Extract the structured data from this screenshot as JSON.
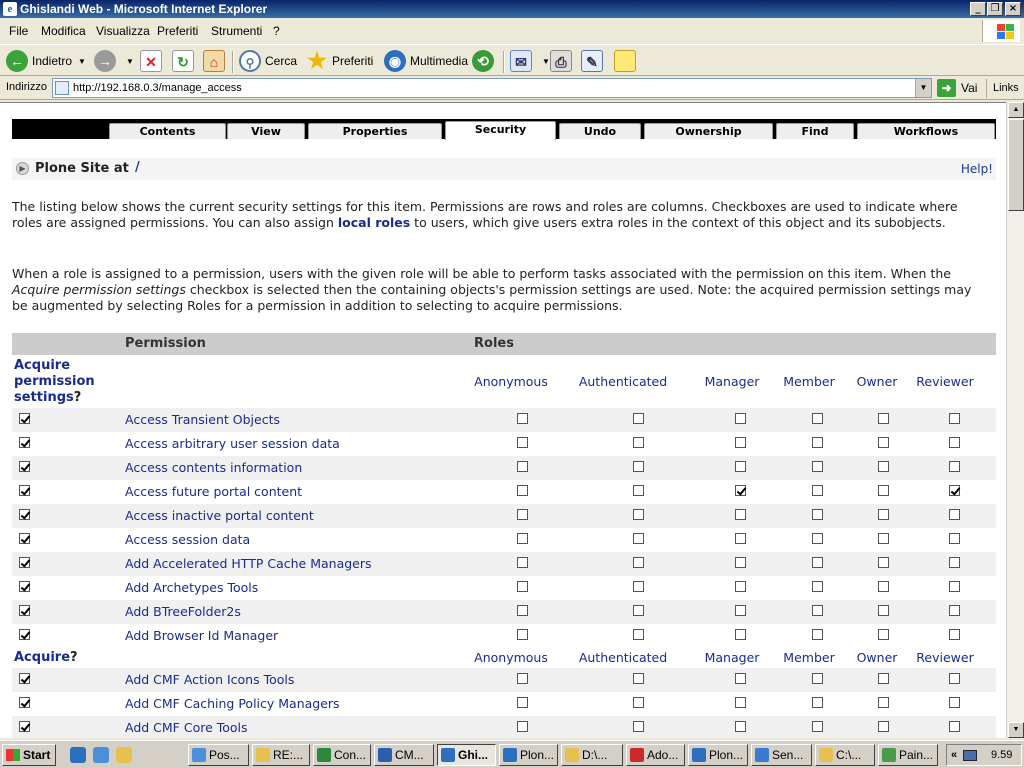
{
  "window": {
    "title": "Ghislandi Web - Microsoft Internet Explorer"
  },
  "menu": [
    "File",
    "Modifica",
    "Visualizza",
    "Preferiti",
    "Strumenti",
    "?"
  ],
  "toolbar": {
    "back": "Indietro",
    "search": "Cerca",
    "favorites": "Preferiti",
    "media": "Multimedia"
  },
  "address": {
    "label": "Indirizzo",
    "url": "http://192.168.0.3/manage_access",
    "go": "Vai",
    "links": "Links"
  },
  "tabs": [
    "Contents",
    "View",
    "Properties",
    "Security",
    "Undo",
    "Ownership",
    "Find",
    "Workflows"
  ],
  "active_tab": "Security",
  "site": {
    "label": "Plone Site at",
    "path": "/",
    "help": "Help!"
  },
  "intro": {
    "p1_before": "The listing below shows the current security settings for this item. Permissions are rows and roles are columns. Checkboxes are used to indicate where roles are assigned permissions. You can also assign ",
    "p1_link": "local roles",
    "p1_after": " to users, which give users extra roles in the context of this object and its subobjects.",
    "p2_before": "When a role is assigned to a permission, users with the given role will be able to perform tasks associated with the permission on this item. When the ",
    "p2_em": "Acquire permission settings",
    "p2_after": " checkbox is selected then the containing objects's permission settings are used. Note: the acquired permission settings may be augmented by selecting Roles for a permission in addition to selecting to acquire permissions."
  },
  "table": {
    "permission_header": "Permission",
    "roles_header": "Roles",
    "acquire_label_line1": "Acquire",
    "acquire_label_line2": "permission",
    "acquire_label_line3": "settings",
    "acquire_q": "?",
    "acquire_short": "Acquire",
    "roles": [
      "Anonymous",
      "Authenticated",
      "Manager",
      "Member",
      "Owner",
      "Reviewer"
    ],
    "group1": [
      {
        "name": "Access Transient Objects",
        "acquire": true,
        "roles": [
          false,
          false,
          false,
          false,
          false,
          false
        ]
      },
      {
        "name": "Access arbitrary user session data",
        "acquire": true,
        "roles": [
          false,
          false,
          false,
          false,
          false,
          false
        ]
      },
      {
        "name": "Access contents information",
        "acquire": true,
        "roles": [
          false,
          false,
          false,
          false,
          false,
          false
        ]
      },
      {
        "name": "Access future portal content",
        "acquire": true,
        "roles": [
          false,
          false,
          true,
          false,
          false,
          true
        ]
      },
      {
        "name": "Access inactive portal content",
        "acquire": true,
        "roles": [
          false,
          false,
          false,
          false,
          false,
          false
        ]
      },
      {
        "name": "Access session data",
        "acquire": true,
        "roles": [
          false,
          false,
          false,
          false,
          false,
          false
        ]
      },
      {
        "name": "Add Accelerated HTTP Cache Managers",
        "acquire": true,
        "roles": [
          false,
          false,
          false,
          false,
          false,
          false
        ]
      },
      {
        "name": "Add Archetypes Tools",
        "acquire": true,
        "roles": [
          false,
          false,
          false,
          false,
          false,
          false
        ]
      },
      {
        "name": "Add BTreeFolder2s",
        "acquire": true,
        "roles": [
          false,
          false,
          false,
          false,
          false,
          false
        ]
      },
      {
        "name": "Add Browser Id Manager",
        "acquire": true,
        "roles": [
          false,
          false,
          false,
          false,
          false,
          false
        ]
      }
    ],
    "group2": [
      {
        "name": "Add CMF Action Icons Tools",
        "acquire": true,
        "roles": [
          false,
          false,
          false,
          false,
          false,
          false
        ]
      },
      {
        "name": "Add CMF Caching Policy Managers",
        "acquire": true,
        "roles": [
          false,
          false,
          false,
          false,
          false,
          false
        ]
      },
      {
        "name": "Add CMF Core Tools",
        "acquire": true,
        "roles": [
          false,
          false,
          false,
          false,
          false,
          false
        ]
      }
    ]
  },
  "taskbar": {
    "start": "Start",
    "tasks": [
      "Pos...",
      "RE:...",
      "Con...",
      "CM...",
      "Ghi...",
      "Plon...",
      "D:\\...",
      "Ado...",
      "Plon...",
      "Sen...",
      "C:\\...",
      "Pain..."
    ],
    "active_task": "Ghi...",
    "tray_expand": "«",
    "clock": "9.59"
  }
}
